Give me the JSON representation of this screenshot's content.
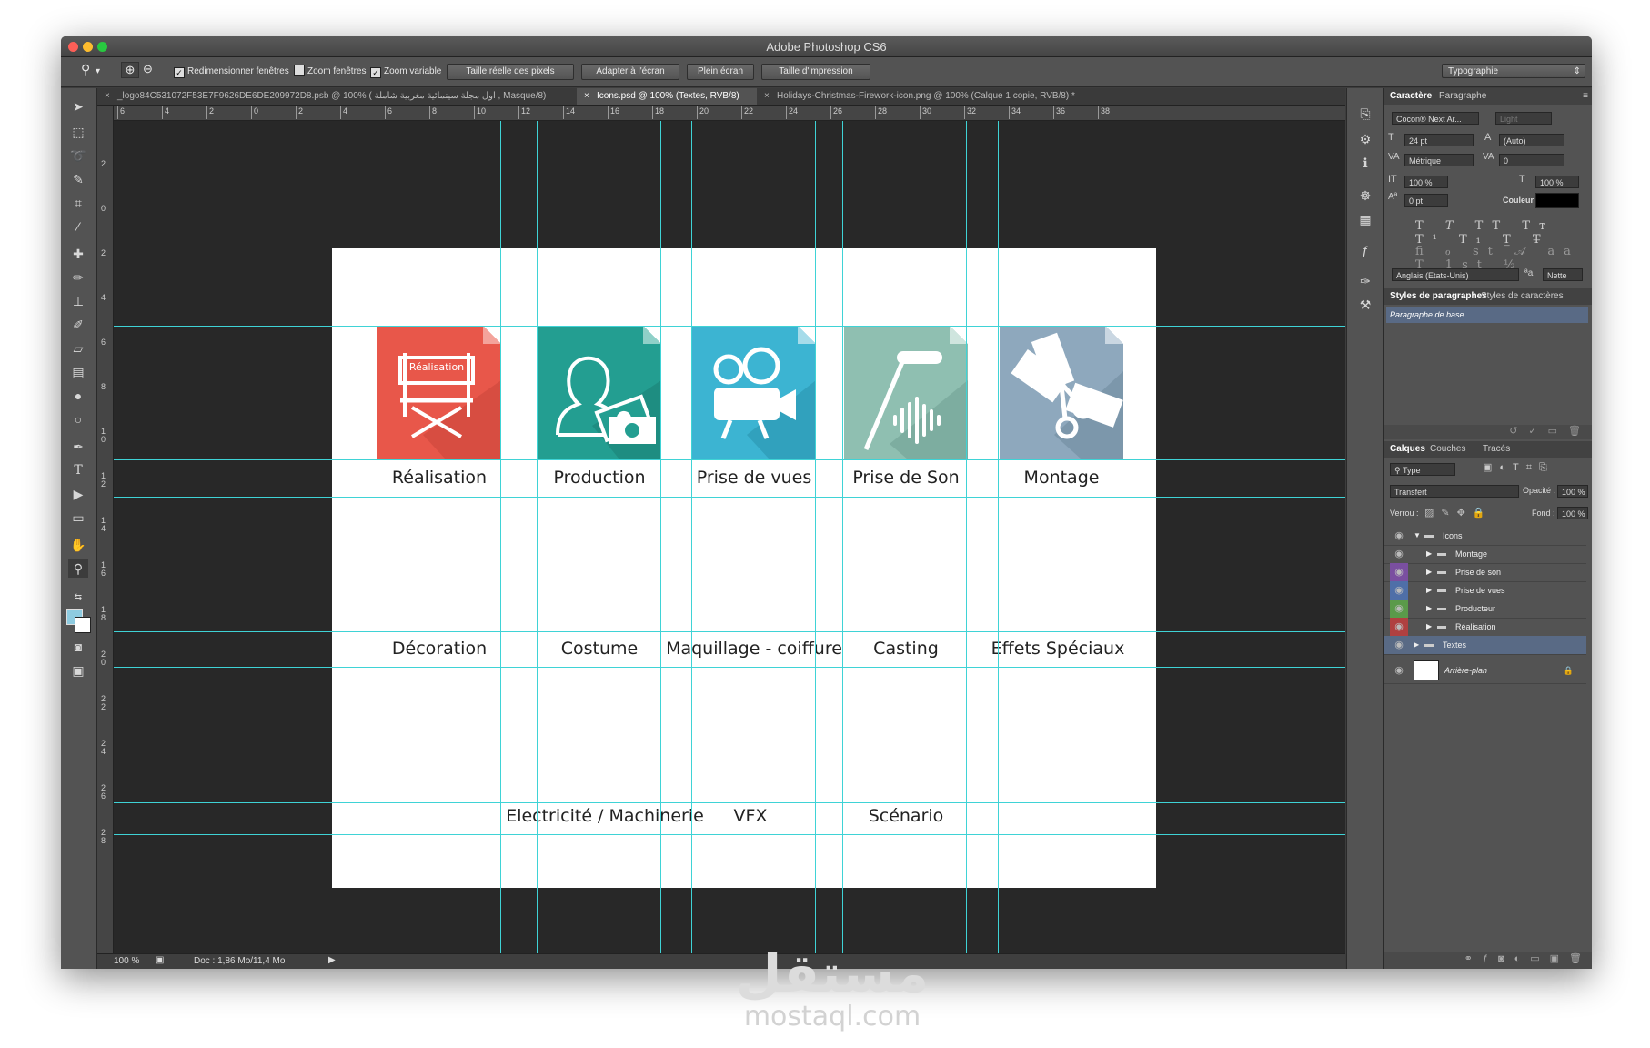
{
  "window": {
    "title": "Adobe Photoshop CS6"
  },
  "options_bar": {
    "resize_windows": "Redimensionner fenêtres",
    "zoom_windows": "Zoom fenêtres",
    "scrubby_zoom": "Zoom variable",
    "actual_pixels": "Taille réelle des pixels",
    "fit_screen": "Adapter à l'écran",
    "full_screen": "Plein écran",
    "print_size": "Taille d'impression",
    "workspace": "Typographie"
  },
  "tabs": [
    "_logo84C531072F53E7F9626DE6DE209972D8.psb @ 100% ( اول مجلة سينمائية مغربية شاملة , Masque/8)",
    "Icons.psd @ 100% (Textes, RVB/8)",
    "Holidays-Christmas-Firework-icon.png @ 100% (Calque 1 copie, RVB/8) *"
  ],
  "ruler_top_ticks": [
    "6",
    "4",
    "2",
    "0",
    "2",
    "4",
    "6",
    "8",
    "10",
    "12",
    "14",
    "16",
    "18",
    "20",
    "22",
    "24",
    "26",
    "28",
    "30",
    "32",
    "34",
    "36",
    "38"
  ],
  "ruler_left_ticks": [
    "2",
    "0",
    "2",
    "4",
    "6",
    "8",
    "1 0",
    "1 2",
    "1 4",
    "1 6",
    "1 8",
    "2 0",
    "2 2",
    "2 4",
    "2 6",
    "2 8"
  ],
  "document": {
    "icons": [
      {
        "label": "Réalisation",
        "color": "#e8574a",
        "badge": "Réalisation"
      },
      {
        "label": "Production",
        "color": "#239e91"
      },
      {
        "label": "Prise de vues",
        "color": "#3cb4d2"
      },
      {
        "label": "Prise de Son",
        "color": "#8fbfb1"
      },
      {
        "label": "Montage",
        "color": "#8ea8bd"
      }
    ],
    "row2": [
      "Décoration",
      "Costume",
      "Maquillage - coiffure",
      "Casting",
      "Effets Spéciaux"
    ],
    "row3": [
      "Electricité / Machinerie",
      "VFX",
      "Scénario"
    ]
  },
  "status": {
    "zoom": "100 %",
    "doc": "Doc : 1,86 Mo/11,4 Mo"
  },
  "character_panel": {
    "tabs": [
      "Caractère",
      "Paragraphe"
    ],
    "font": "Cocon® Next Ar...",
    "style": "Light",
    "size": "24 pt",
    "leading": "(Auto)",
    "kerning": "Métrique",
    "tracking": "0",
    "vscale": "100 %",
    "hscale": "100 %",
    "baseline": "0 pt",
    "color_label": "Couleur :",
    "language": "Anglais (Etats-Unis)",
    "aa_label": "ªa",
    "aa": "Nette"
  },
  "para_styles_panel": {
    "tabs": [
      "Styles de paragraphes",
      "Styles de caractères"
    ],
    "item": "Paragraphe de base"
  },
  "layers_panel": {
    "tabs": [
      "Calques",
      "Couches",
      "Tracés"
    ],
    "filter": "Type",
    "blend": "Transfert",
    "opacity_label": "Opacité :",
    "opacity": "100 %",
    "lock_label": "Verrou :",
    "fill_label": "Fond :",
    "fill": "100 %",
    "layers": [
      {
        "name": "Icons",
        "indent": 0,
        "color": "",
        "open": true
      },
      {
        "name": "Montage",
        "indent": 1,
        "color": ""
      },
      {
        "name": "Prise de son",
        "indent": 1,
        "color": "#7a4fa0"
      },
      {
        "name": "Prise de vues",
        "indent": 1,
        "color": "#4f6fa8"
      },
      {
        "name": "Producteur",
        "indent": 1,
        "color": "#5a9a4a"
      },
      {
        "name": "Réalisation",
        "indent": 1,
        "color": "#b04040"
      },
      {
        "name": "Textes",
        "indent": 0,
        "color": "",
        "selected": true
      },
      {
        "name": "Arrière-plan",
        "indent": 0,
        "color": "",
        "background": true
      }
    ]
  },
  "watermark": {
    "arabic": "مستقل",
    "latin": "mostaql.com"
  }
}
